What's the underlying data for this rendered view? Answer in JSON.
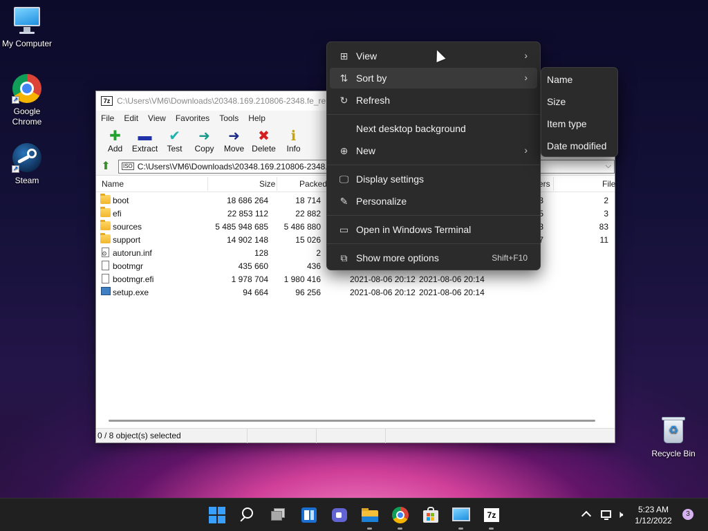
{
  "desktop": {
    "icons": [
      {
        "label": "My Computer"
      },
      {
        "label": "Google Chrome"
      },
      {
        "label": "Steam"
      },
      {
        "label": "Recycle Bin"
      }
    ]
  },
  "window": {
    "title": "C:\\Users\\VM6\\Downloads\\20348.169.210806-2348.fe_relea",
    "logo": "7z",
    "menu": [
      "File",
      "Edit",
      "View",
      "Favorites",
      "Tools",
      "Help"
    ],
    "toolbar": [
      {
        "label": "Add",
        "icon": "plus-icon",
        "glyph": "✚",
        "color": "#1fa32c"
      },
      {
        "label": "Extract",
        "icon": "minus-icon",
        "glyph": "▬",
        "color": "#2233aa"
      },
      {
        "label": "Test",
        "icon": "check-icon",
        "glyph": "✔",
        "color": "#1ab3b0"
      },
      {
        "label": "Copy",
        "icon": "copy-arrow-icon",
        "glyph": "➜",
        "color": "#1a9a8a"
      },
      {
        "label": "Move",
        "icon": "move-arrow-icon",
        "glyph": "➜",
        "color": "#1f2d8a"
      },
      {
        "label": "Delete",
        "icon": "delete-x-icon",
        "glyph": "✖",
        "color": "#d42020"
      },
      {
        "label": "Info",
        "icon": "info-icon",
        "glyph": "ℹ",
        "color": "#c9a400"
      }
    ],
    "address": "C:\\Users\\VM6\\Downloads\\20348.169.210806-2348.fe_",
    "address_tag": "ISO",
    "columns": {
      "name": "Name",
      "size": "Size",
      "packed": "Packed",
      "folders": "ers",
      "files": "File"
    },
    "files": [
      {
        "name": "boot",
        "type": "folder",
        "size": "18 686 264",
        "packed": "18 714",
        "modified": "",
        "created": "",
        "folders": "3",
        "files": "2"
      },
      {
        "name": "efi",
        "type": "folder",
        "size": "22 853 112",
        "packed": "22 882",
        "modified": "",
        "created": "",
        "folders": "5",
        "files": "3"
      },
      {
        "name": "sources",
        "type": "folder",
        "size": "5 485 948 685",
        "packed": "5 486 880",
        "modified": "",
        "created": "",
        "folders": "68",
        "files": "83"
      },
      {
        "name": "support",
        "type": "folder",
        "size": "14 902 148",
        "packed": "15 026",
        "modified": "",
        "created": "",
        "folders": "7",
        "files": "11"
      },
      {
        "name": "autorun.inf",
        "type": "inf",
        "size": "128",
        "packed": "2",
        "modified": "",
        "created": "",
        "folders": "",
        "files": ""
      },
      {
        "name": "bootmgr",
        "type": "file",
        "size": "435 660",
        "packed": "436",
        "modified": "",
        "created": "",
        "folders": "",
        "files": ""
      },
      {
        "name": "bootmgr.efi",
        "type": "file",
        "size": "1 978 704",
        "packed": "1 980 416",
        "modified": "2021-08-06 20:12",
        "created": "2021-08-06 20:14",
        "folders": "",
        "files": ""
      },
      {
        "name": "setup.exe",
        "type": "exe",
        "size": "94 664",
        "packed": "96 256",
        "modified": "2021-08-06 20:12",
        "created": "2021-08-06 20:14",
        "folders": "",
        "files": ""
      }
    ],
    "status": "0 / 8 object(s) selected"
  },
  "context_menu": {
    "items": [
      {
        "label": "View",
        "icon": "view-grid-icon",
        "submenu": true
      },
      {
        "label": "Sort by",
        "icon": "sort-icon",
        "submenu": true
      },
      {
        "label": "Refresh",
        "icon": "refresh-icon",
        "submenu": false
      },
      {
        "label": "Next desktop background",
        "icon": "",
        "submenu": false
      },
      {
        "label": "New",
        "icon": "new-plus-icon",
        "submenu": true
      },
      {
        "label": "Display settings",
        "icon": "display-icon",
        "submenu": false
      },
      {
        "label": "Personalize",
        "icon": "brush-icon",
        "submenu": false
      },
      {
        "label": "Open in Windows Terminal",
        "icon": "terminal-icon",
        "submenu": false
      },
      {
        "label": "Show more options",
        "icon": "more-options-icon",
        "submenu": false,
        "accelerator": "Shift+F10"
      }
    ],
    "sort_submenu": [
      "Name",
      "Size",
      "Item type",
      "Date modified"
    ]
  },
  "taskbar": {
    "apps": [
      "start-icon",
      "search-icon",
      "task-view-icon",
      "widgets-icon",
      "chat-icon",
      "file-explorer-icon",
      "chrome-icon",
      "store-icon",
      "control-panel-icon",
      "7zip-icon"
    ],
    "time": "5:23 AM",
    "date": "1/12/2022",
    "notifications": "3"
  }
}
